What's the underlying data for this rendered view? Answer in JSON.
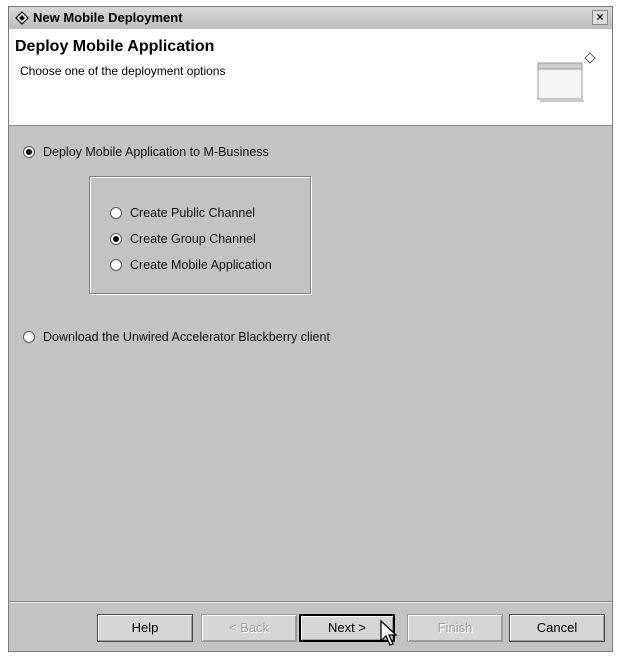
{
  "window": {
    "title": "New Mobile Deployment",
    "close_label": "×"
  },
  "banner": {
    "title": "Deploy Mobile Application",
    "subtitle": "Choose one of the deployment options"
  },
  "options": {
    "deploy_m_business": {
      "label": "Deploy Mobile Application to M-Business",
      "checked": true
    },
    "channel_options": [
      {
        "label": "Create Public Channel",
        "checked": false
      },
      {
        "label": "Create Group Channel",
        "checked": true
      },
      {
        "label": "Create Mobile Application",
        "checked": false
      }
    ],
    "download_client": {
      "label": "Download the Unwired Accelerator Blackberry client",
      "checked": false
    }
  },
  "buttons": {
    "help": "Help",
    "back": "< Back",
    "next": "Next >",
    "finish": "Finish",
    "cancel": "Cancel"
  },
  "icons": {
    "title_icon": "diamond-icon",
    "banner_graphic": "wizard-window-icon",
    "cursor": "mouse-pointer-icon"
  }
}
